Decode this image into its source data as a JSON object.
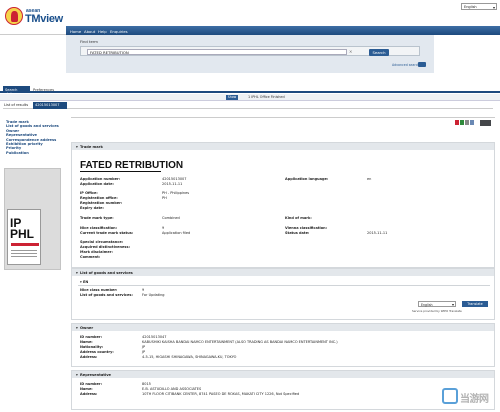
{
  "header": {
    "logo": {
      "small": "asean",
      "big": "TMview"
    },
    "language": "English",
    "nav": [
      "Home",
      "About",
      "Help",
      "Enquiries"
    ]
  },
  "search": {
    "label": "Find term",
    "value": "FATED RETRIBUTION",
    "button": "Search",
    "advanced": "Advanced search"
  },
  "tabs": [
    "Search status",
    "Preferences"
  ],
  "status": {
    "show_button": "Show",
    "office_text": "1   IPHL   Office Finished"
  },
  "results": {
    "label": "List of results",
    "selected_id": "42015013007"
  },
  "sidebar": {
    "links": [
      "Trade mark",
      "List of goods and services",
      "Owner",
      "Representative",
      "Correspondence address",
      "Exhibition priority",
      "Priority",
      "Publication"
    ],
    "ad": {
      "logo_line1": "IP",
      "logo_line2": "PHL"
    }
  },
  "trademark": {
    "section_title": "Trade mark",
    "name": "FATED RETRIBUTION",
    "left_fields": [
      {
        "label": "Application number:",
        "value": "42015013007"
      },
      {
        "label": "Application date:",
        "value": "2015-11-11"
      },
      {
        "label": "IP Office:",
        "value": "PH - Philippines"
      },
      {
        "label": "Registration office:",
        "value": "PH"
      },
      {
        "label": "Registration number:",
        "value": ""
      },
      {
        "label": "Expiry date:",
        "value": ""
      },
      {
        "label": "Trade mark type:",
        "value": "Combined"
      },
      {
        "label": "Nice classification:",
        "value": "9"
      },
      {
        "label": "Current trade mark status:",
        "value": "Application filed"
      },
      {
        "label": "Special circumstance:",
        "value": ""
      },
      {
        "label": "Acquired distinctiveness:",
        "value": ""
      },
      {
        "label": "Mark disclaimer:",
        "value": ""
      },
      {
        "label": "Comment:",
        "value": ""
      }
    ],
    "right_fields": [
      {
        "label": "Application language:",
        "value": "en"
      },
      {
        "label": "Kind of mark:",
        "value": ""
      },
      {
        "label": "Vienna classification:",
        "value": ""
      },
      {
        "label": "Status date:",
        "value": "2015-11-11"
      }
    ]
  },
  "goods": {
    "section_title": "List of goods and services",
    "lang": "EN",
    "fields": [
      {
        "label": "Nice class number:",
        "value": "9"
      },
      {
        "label": "List of goods and services:",
        "value": "For Updating"
      }
    ],
    "translate_lang": "English",
    "translate_button": "Translate",
    "service_note": "Service provided by WIPO Translate"
  },
  "owner": {
    "section_title": "Owner",
    "fields": [
      {
        "label": "ID number:",
        "value": "42015013047"
      },
      {
        "label": "Name:",
        "value": "KABUSHIKI KAISHA BANDAI NAMCO ENTERTAINMENT (ALSO TRADING AS BANDAI NAMCO ENTERTAINMENT INC.)"
      },
      {
        "label": "Nationality:",
        "value": "JP"
      },
      {
        "label": "Address country:",
        "value": "JP"
      },
      {
        "label": "Address:",
        "value": "4-5-15, HIGASHI SHINAGAWA, SHINAGAWA-KU, TOKYO"
      }
    ]
  },
  "representative": {
    "section_title": "Representative",
    "fields": [
      {
        "label": "ID number:",
        "value": "8015"
      },
      {
        "label": "Name:",
        "value": "E.B. ASTUDILLO AND ASSOCIATES"
      },
      {
        "label": "Address:",
        "value": "10TH FLOOR CITIBANK CENTER, 8741 PASEO DE ROXAS, MAKATI CITY 1226, Not Specified"
      }
    ]
  },
  "watermark": {
    "text": "当游网"
  }
}
